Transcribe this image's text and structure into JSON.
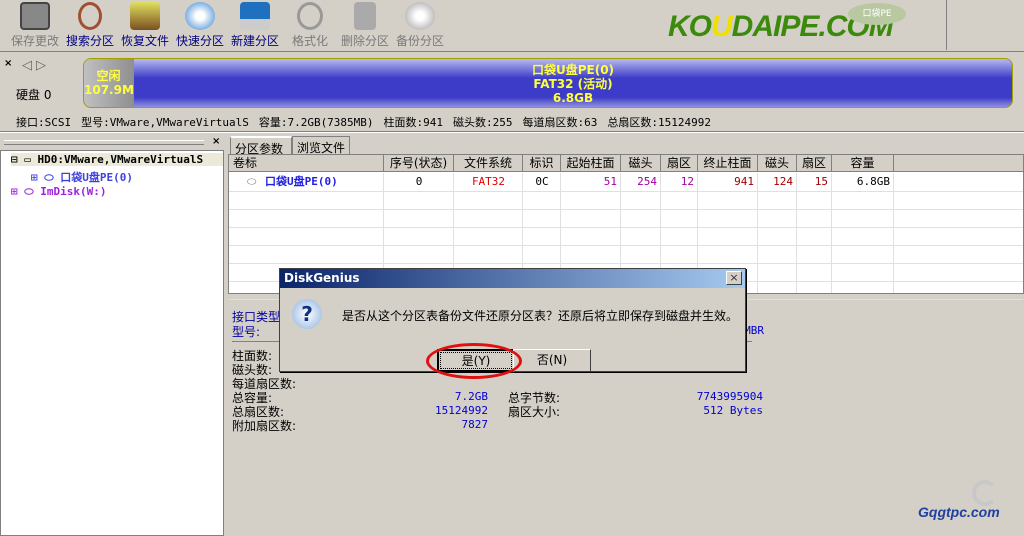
{
  "toolbar": {
    "items": [
      {
        "label": "保存更改",
        "enabled": false,
        "icon": "save-icon"
      },
      {
        "label": "搜索分区",
        "enabled": true,
        "icon": "magnifier-icon"
      },
      {
        "label": "恢复文件",
        "enabled": true,
        "icon": "restore-box-icon"
      },
      {
        "label": "快速分区",
        "enabled": true,
        "icon": "quick-partition-icon"
      },
      {
        "label": "新建分区",
        "enabled": true,
        "icon": "laptop-icon"
      },
      {
        "label": "格式化",
        "enabled": false,
        "icon": "format-icon"
      },
      {
        "label": "删除分区",
        "enabled": false,
        "icon": "trash-icon"
      },
      {
        "label": "备份分区",
        "enabled": false,
        "icon": "backup-disc-icon"
      }
    ]
  },
  "logo": {
    "text_main": "KO",
    "text_u": "U",
    "text_rest": "DAIPE.COM",
    "badge": "口袋PE"
  },
  "disk": {
    "label": "硬盘 0",
    "free_label": "空闲",
    "free_size": "107.9MB",
    "partition_name": "口袋U盘PE(0)",
    "partition_fs": "FAT32 (活动)",
    "partition_size": "6.8GB",
    "info": [
      "接口:SCSI",
      "型号:VMware,VMwareVirtualS",
      "容量:7.2GB(7385MB)",
      "柱面数:941",
      "磁头数:255",
      "每道扇区数:63",
      "总扇区数:15124992"
    ]
  },
  "tree": {
    "disk": "HD0:VMware,VMwareVirtualS",
    "partition": "口袋U盘PE(0)",
    "imdisk": "ImDisk(W:)"
  },
  "tabs": [
    "分区参数",
    "浏览文件"
  ],
  "table": {
    "headers": [
      "卷标",
      "序号(状态)",
      "文件系统",
      "标识",
      "起始柱面",
      "磁头",
      "扇区",
      "终止柱面",
      "磁头",
      "扇区",
      "容量"
    ],
    "rows": [
      [
        "口袋U盘PE(0)",
        "0",
        "FAT32",
        "0C",
        "51",
        "254",
        "12",
        "941",
        "124",
        "15",
        "6.8GB"
      ]
    ]
  },
  "details": {
    "labels": [
      "接口类型:",
      "型号:",
      "柱面数:",
      "磁头数:",
      "每道扇区数:",
      "总容量:",
      "总扇区数:",
      "附加扇区数:",
      "总字节数:",
      "扇区大小:"
    ],
    "total_capacity": "7.2GB",
    "total_sectors": "15124992",
    "extra_sectors": "7827",
    "total_bytes": "7743995904",
    "sector_size": "512 Bytes",
    "partition_style": "MBR"
  },
  "dialog": {
    "title": "DiskGenius",
    "close": "×",
    "message": "是否从这个分区表备份文件还原分区表？还原后将立即保存到磁盘并生效。",
    "yes": "是(Y)",
    "no": "否(N)"
  },
  "watermark": "Gqgtpc.com"
}
